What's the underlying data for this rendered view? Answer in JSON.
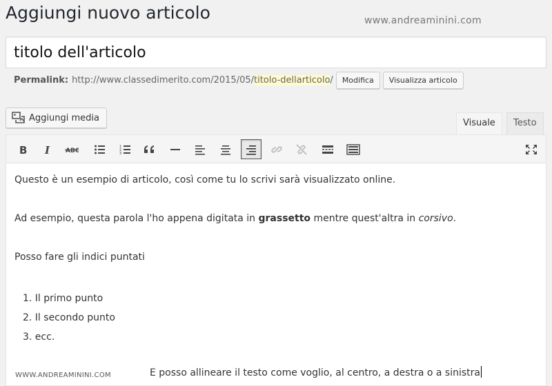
{
  "page": {
    "title": "Aggiungi nuovo articolo",
    "watermark_top": "www.andreaminini.com",
    "watermark_bottom": "WWW.ANDREAMININI.COM"
  },
  "post": {
    "title_value": "titolo dell'articolo",
    "permalink_label": "Permalink:",
    "permalink_base": "http://www.classedimerito.com/2015/05/",
    "permalink_slug": "titolo-dellarticolo",
    "permalink_trailing": "/",
    "edit_button": "Modifica",
    "view_button": "Visualizza articolo"
  },
  "editor": {
    "add_media_label": "Aggiungi media",
    "tabs": [
      {
        "label": "Visuale",
        "active": true
      },
      {
        "label": "Testo",
        "active": false
      }
    ],
    "toolbar": [
      {
        "icon": "bold-icon"
      },
      {
        "icon": "italic-icon"
      },
      {
        "icon": "strikethrough-icon"
      },
      {
        "icon": "bulleted-list-icon"
      },
      {
        "icon": "numbered-list-icon"
      },
      {
        "icon": "blockquote-icon"
      },
      {
        "icon": "horizontal-line-icon"
      },
      {
        "icon": "align-left-icon"
      },
      {
        "icon": "align-center-icon"
      },
      {
        "icon": "align-right-icon",
        "active": true
      },
      {
        "icon": "insert-link-icon",
        "disabled": true
      },
      {
        "icon": "remove-link-icon",
        "disabled": true
      },
      {
        "icon": "read-more-icon"
      },
      {
        "icon": "toolbar-toggle-icon"
      },
      {
        "icon": "fullscreen-icon"
      }
    ],
    "content": {
      "p1": "Questo è un esempio di articolo, così come tu lo scrivi sarà visualizzato online.",
      "p2_before": "Ad esempio, questa parola l'ho appena digitata in ",
      "p2_bold": "grassetto",
      "p2_middle": " mentre quest'altra in ",
      "p2_italic": "corsivo",
      "p2_after": ".",
      "p3": "Posso fare gli indici puntati",
      "list": [
        "1. Il primo punto",
        "2. Il secondo punto",
        "3. ecc."
      ],
      "p4": "E  posso allineare il testo come voglio, al centro, a destra o a sinistra"
    }
  }
}
